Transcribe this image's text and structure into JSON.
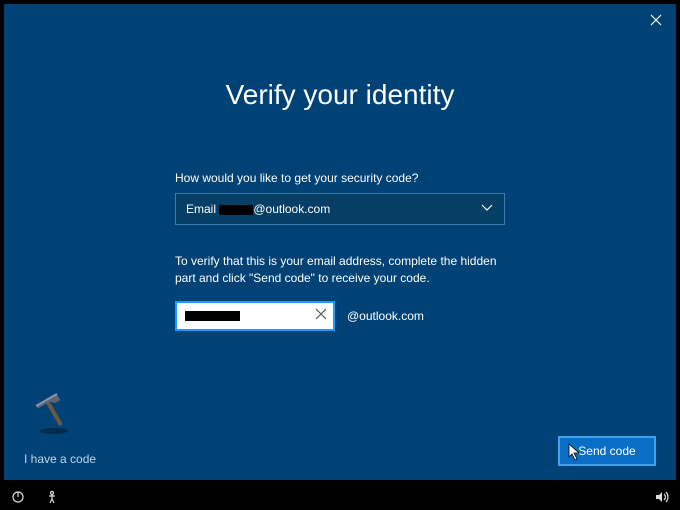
{
  "title": "Verify your identity",
  "question": "How would you like to get your security code?",
  "select": {
    "prefix": "Email ",
    "masked_domain_suffix": "@outlook.com"
  },
  "instruction": "To verify that this is your email address, complete the hidden part and click \"Send code\" to receive your code.",
  "email_domain": "@outlook.com",
  "have_code_label": "I have a code",
  "send_label": "Send code"
}
